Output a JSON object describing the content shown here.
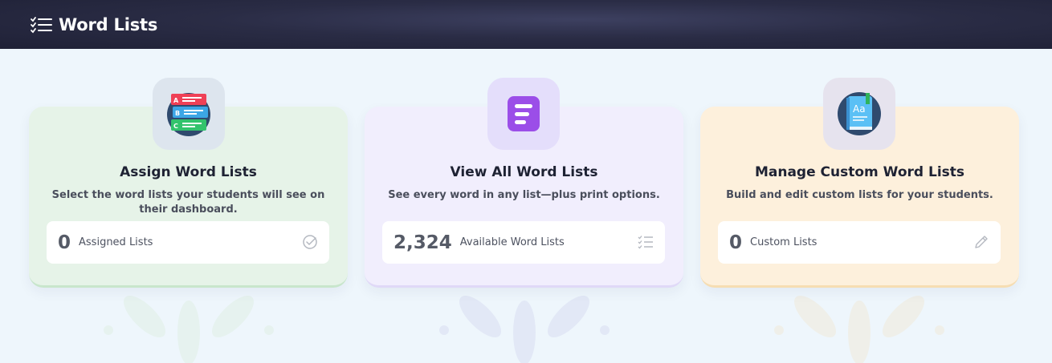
{
  "header": {
    "title": "Word Lists",
    "icon": "list-check-icon"
  },
  "cards": [
    {
      "title": "Assign Word Lists",
      "description": "Select the word lists your students will see on their dashboard.",
      "stat_value": "0",
      "stat_label": "Assigned Lists",
      "icon": "assign-lists-icon",
      "stat_icon": "check-circle-icon",
      "accent": "#e6f3e8"
    },
    {
      "title": "View All Word Lists",
      "description": "See every word in any list—plus print options.",
      "stat_value": "2,324",
      "stat_label": "Available Word Lists",
      "icon": "view-lists-icon",
      "stat_icon": "list-check-icon",
      "accent": "#f1eefd"
    },
    {
      "title": "Manage Custom Word Lists",
      "description": "Build and edit custom lists for your students.",
      "stat_value": "0",
      "stat_label": "Custom Lists",
      "icon": "book-icon",
      "stat_icon": "pencil-icon",
      "accent": "#fdf0dc"
    }
  ]
}
